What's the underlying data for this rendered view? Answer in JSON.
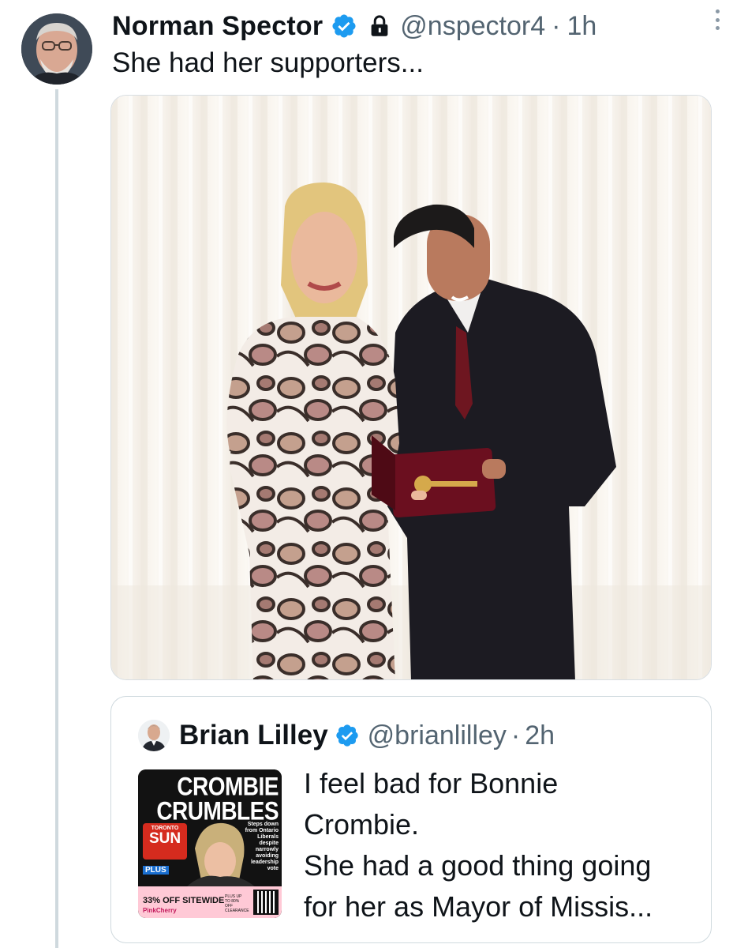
{
  "tweet": {
    "author_name": "Norman Spector",
    "handle": "@nspector4",
    "separator": "·",
    "time": "1h",
    "text": "She had her supporters...",
    "verified_color": "#1d9bf0"
  },
  "quoted_tweet": {
    "author_name": "Brian Lilley",
    "handle": "@brianlilley",
    "separator": "·",
    "time": "2h",
    "text_lines": [
      "I feel bad for Bonnie",
      "Crombie.",
      "She had a good thing going",
      "for her as Mayor of Missis..."
    ]
  },
  "thumbnail": {
    "headline": "CROMBIE CRUMBLES",
    "paper_city": "TORONTO",
    "paper_name": "SUN",
    "subhead": "Steps down from Ontario Liberals despite narrowly avoiding leadership vote",
    "plus_label": "PLUS",
    "ad_text": "33% OFF SITEWIDE",
    "ad_brand": "PinkCherry",
    "ad_small": "PLUS UP TO 80% OFF CLEARANCE"
  },
  "icons": {
    "verified": "verified-badge-icon",
    "lock": "lock-icon",
    "more": "more-options-icon"
  },
  "colors": {
    "text_primary": "#0f1419",
    "text_secondary": "#536471",
    "border": "#cfd9de",
    "verified": "#1d9bf0"
  }
}
